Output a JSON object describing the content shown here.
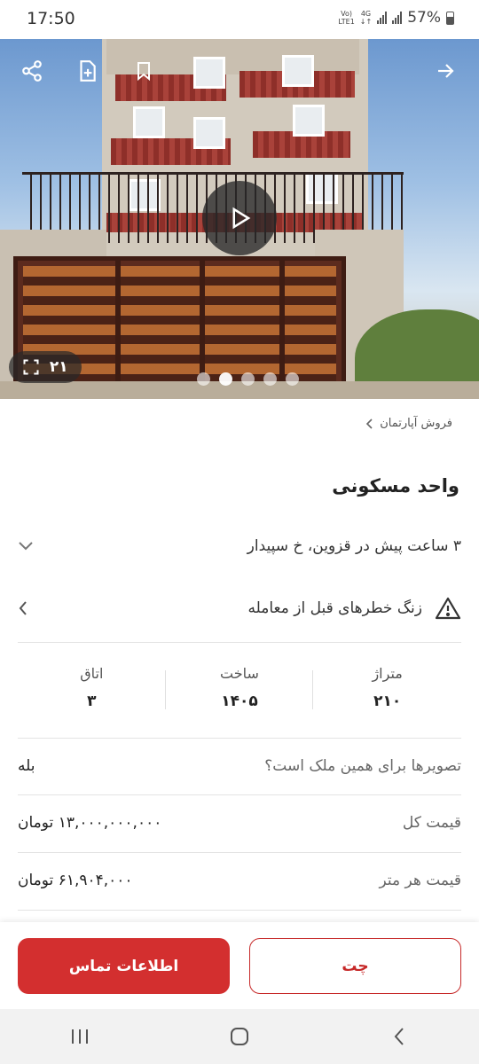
{
  "status_bar": {
    "time": "17:50",
    "network_top": "Vo)",
    "network_bottom": "LTE1",
    "net_type": "4G",
    "battery": "57%"
  },
  "gallery": {
    "image_count": "۲۱",
    "dot_count": 5,
    "active_dot": 1
  },
  "breadcrumb": {
    "label": "فروش آپارتمان"
  },
  "listing": {
    "title": "واحد مسکونی",
    "meta": "۳ ساعت پیش در قزوین، خ سپیدار",
    "warning": "زنگ خطرهای قبل از معامله"
  },
  "stats": [
    {
      "label": "متراژ",
      "value": "۲۱۰"
    },
    {
      "label": "ساخت",
      "value": "۱۴۰۵"
    },
    {
      "label": "اتاق",
      "value": "۳"
    }
  ],
  "details": [
    {
      "label": "تصویرها برای همین ملک است؟",
      "value": "بله"
    },
    {
      "label": "قیمت کل",
      "value": "۱۳,۰۰۰,۰۰۰,۰۰۰ تومان"
    },
    {
      "label": "قیمت هر متر",
      "value": "۶۱,۹۰۴,۰۰۰ تومان"
    }
  ],
  "actions": {
    "chat": "چت",
    "contact": "اطلاعات تماس"
  },
  "icons": [
    "share-icon",
    "add-note-icon",
    "bookmark-icon",
    "arrow-forward-icon",
    "play-icon",
    "fullscreen-icon",
    "chevron-down-icon",
    "warning-icon",
    "chevron-left-icon"
  ],
  "colors": {
    "accent": "#d32f2f"
  }
}
